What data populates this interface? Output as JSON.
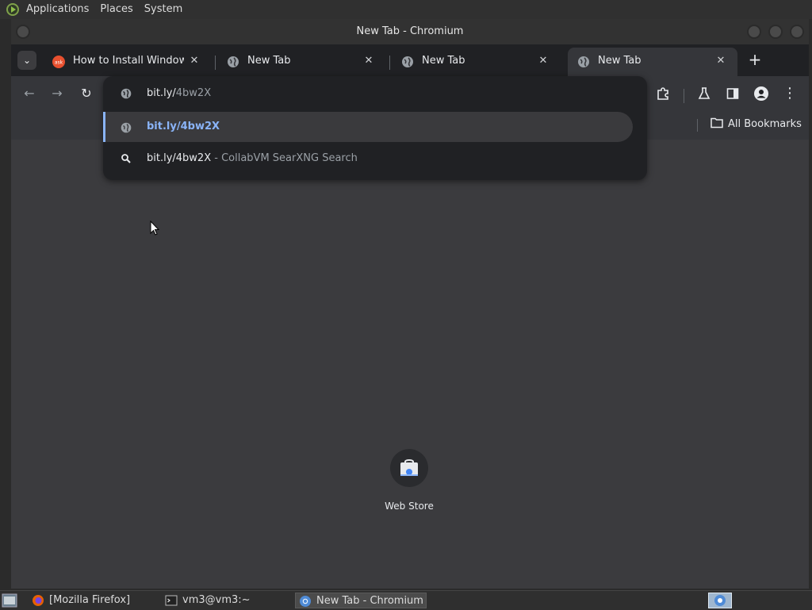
{
  "panel": {
    "applications": "Applications",
    "places": "Places",
    "system": "System"
  },
  "window": {
    "title": "New Tab - Chromium"
  },
  "tabs": [
    {
      "title": "How to Install Windows Media Player",
      "favicon": "ask-icon"
    },
    {
      "title": "New Tab",
      "favicon": "globe-icon"
    },
    {
      "title": "New Tab",
      "favicon": "globe-icon"
    },
    {
      "title": "New Tab",
      "favicon": "globe-icon",
      "active": true
    }
  ],
  "omnibox": {
    "input_typed": "bit.ly/",
    "input_autocomplete": "4bw2X",
    "suggestions": [
      {
        "text": "bit.ly/4bw2X",
        "icon": "globe-icon",
        "selected": true
      },
      {
        "text": "bit.ly/4bw2X",
        "suffix": " - CollabVM SearXNG Search",
        "icon": "search-icon"
      }
    ]
  },
  "bookmarks": {
    "all_bookmarks": "All Bookmarks"
  },
  "shortcuts": [
    {
      "label": "Web Store"
    }
  ],
  "taskbar": {
    "items": [
      {
        "label": "[Mozilla Firefox]"
      },
      {
        "label": "vm3@vm3:~"
      },
      {
        "label": "New Tab - Chromium",
        "active": true
      }
    ]
  },
  "colors": {
    "accent": "#8ab4f8",
    "background": "#3b3b3e",
    "tabstrip": "#202124"
  }
}
